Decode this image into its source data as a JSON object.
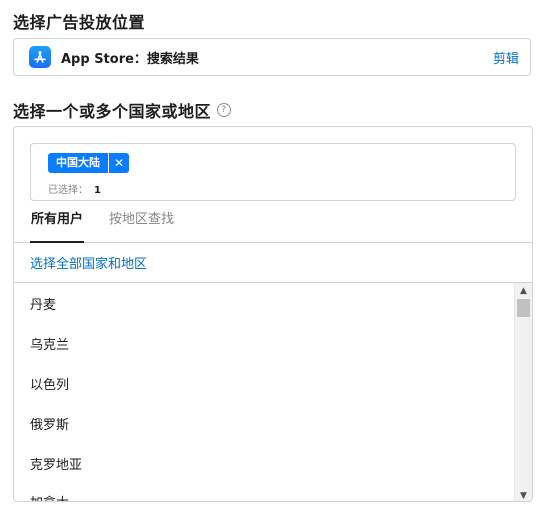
{
  "placement": {
    "title": "选择广告投放位置",
    "label": "App Store：搜索结果",
    "edit_label": "剪辑",
    "icon": "app-store-icon"
  },
  "country": {
    "title": "选择一个或多个国家或地区",
    "help_icon": "?",
    "chip_label": "中国大陆",
    "chip_remove": "✕",
    "selected_label": "已选择：",
    "selected_count": "1",
    "tabs": [
      {
        "label": "所有用户",
        "active": true
      },
      {
        "label": "按地区查找",
        "active": false
      }
    ],
    "select_all": "选择全部国家和地区",
    "items": [
      "丹麦",
      "乌克兰",
      "以色列",
      "俄罗斯",
      "克罗地亚",
      "加拿大"
    ]
  },
  "colors": {
    "accent": "#0a7cff",
    "link": "#0070c9",
    "border": "#d2d2d7"
  }
}
